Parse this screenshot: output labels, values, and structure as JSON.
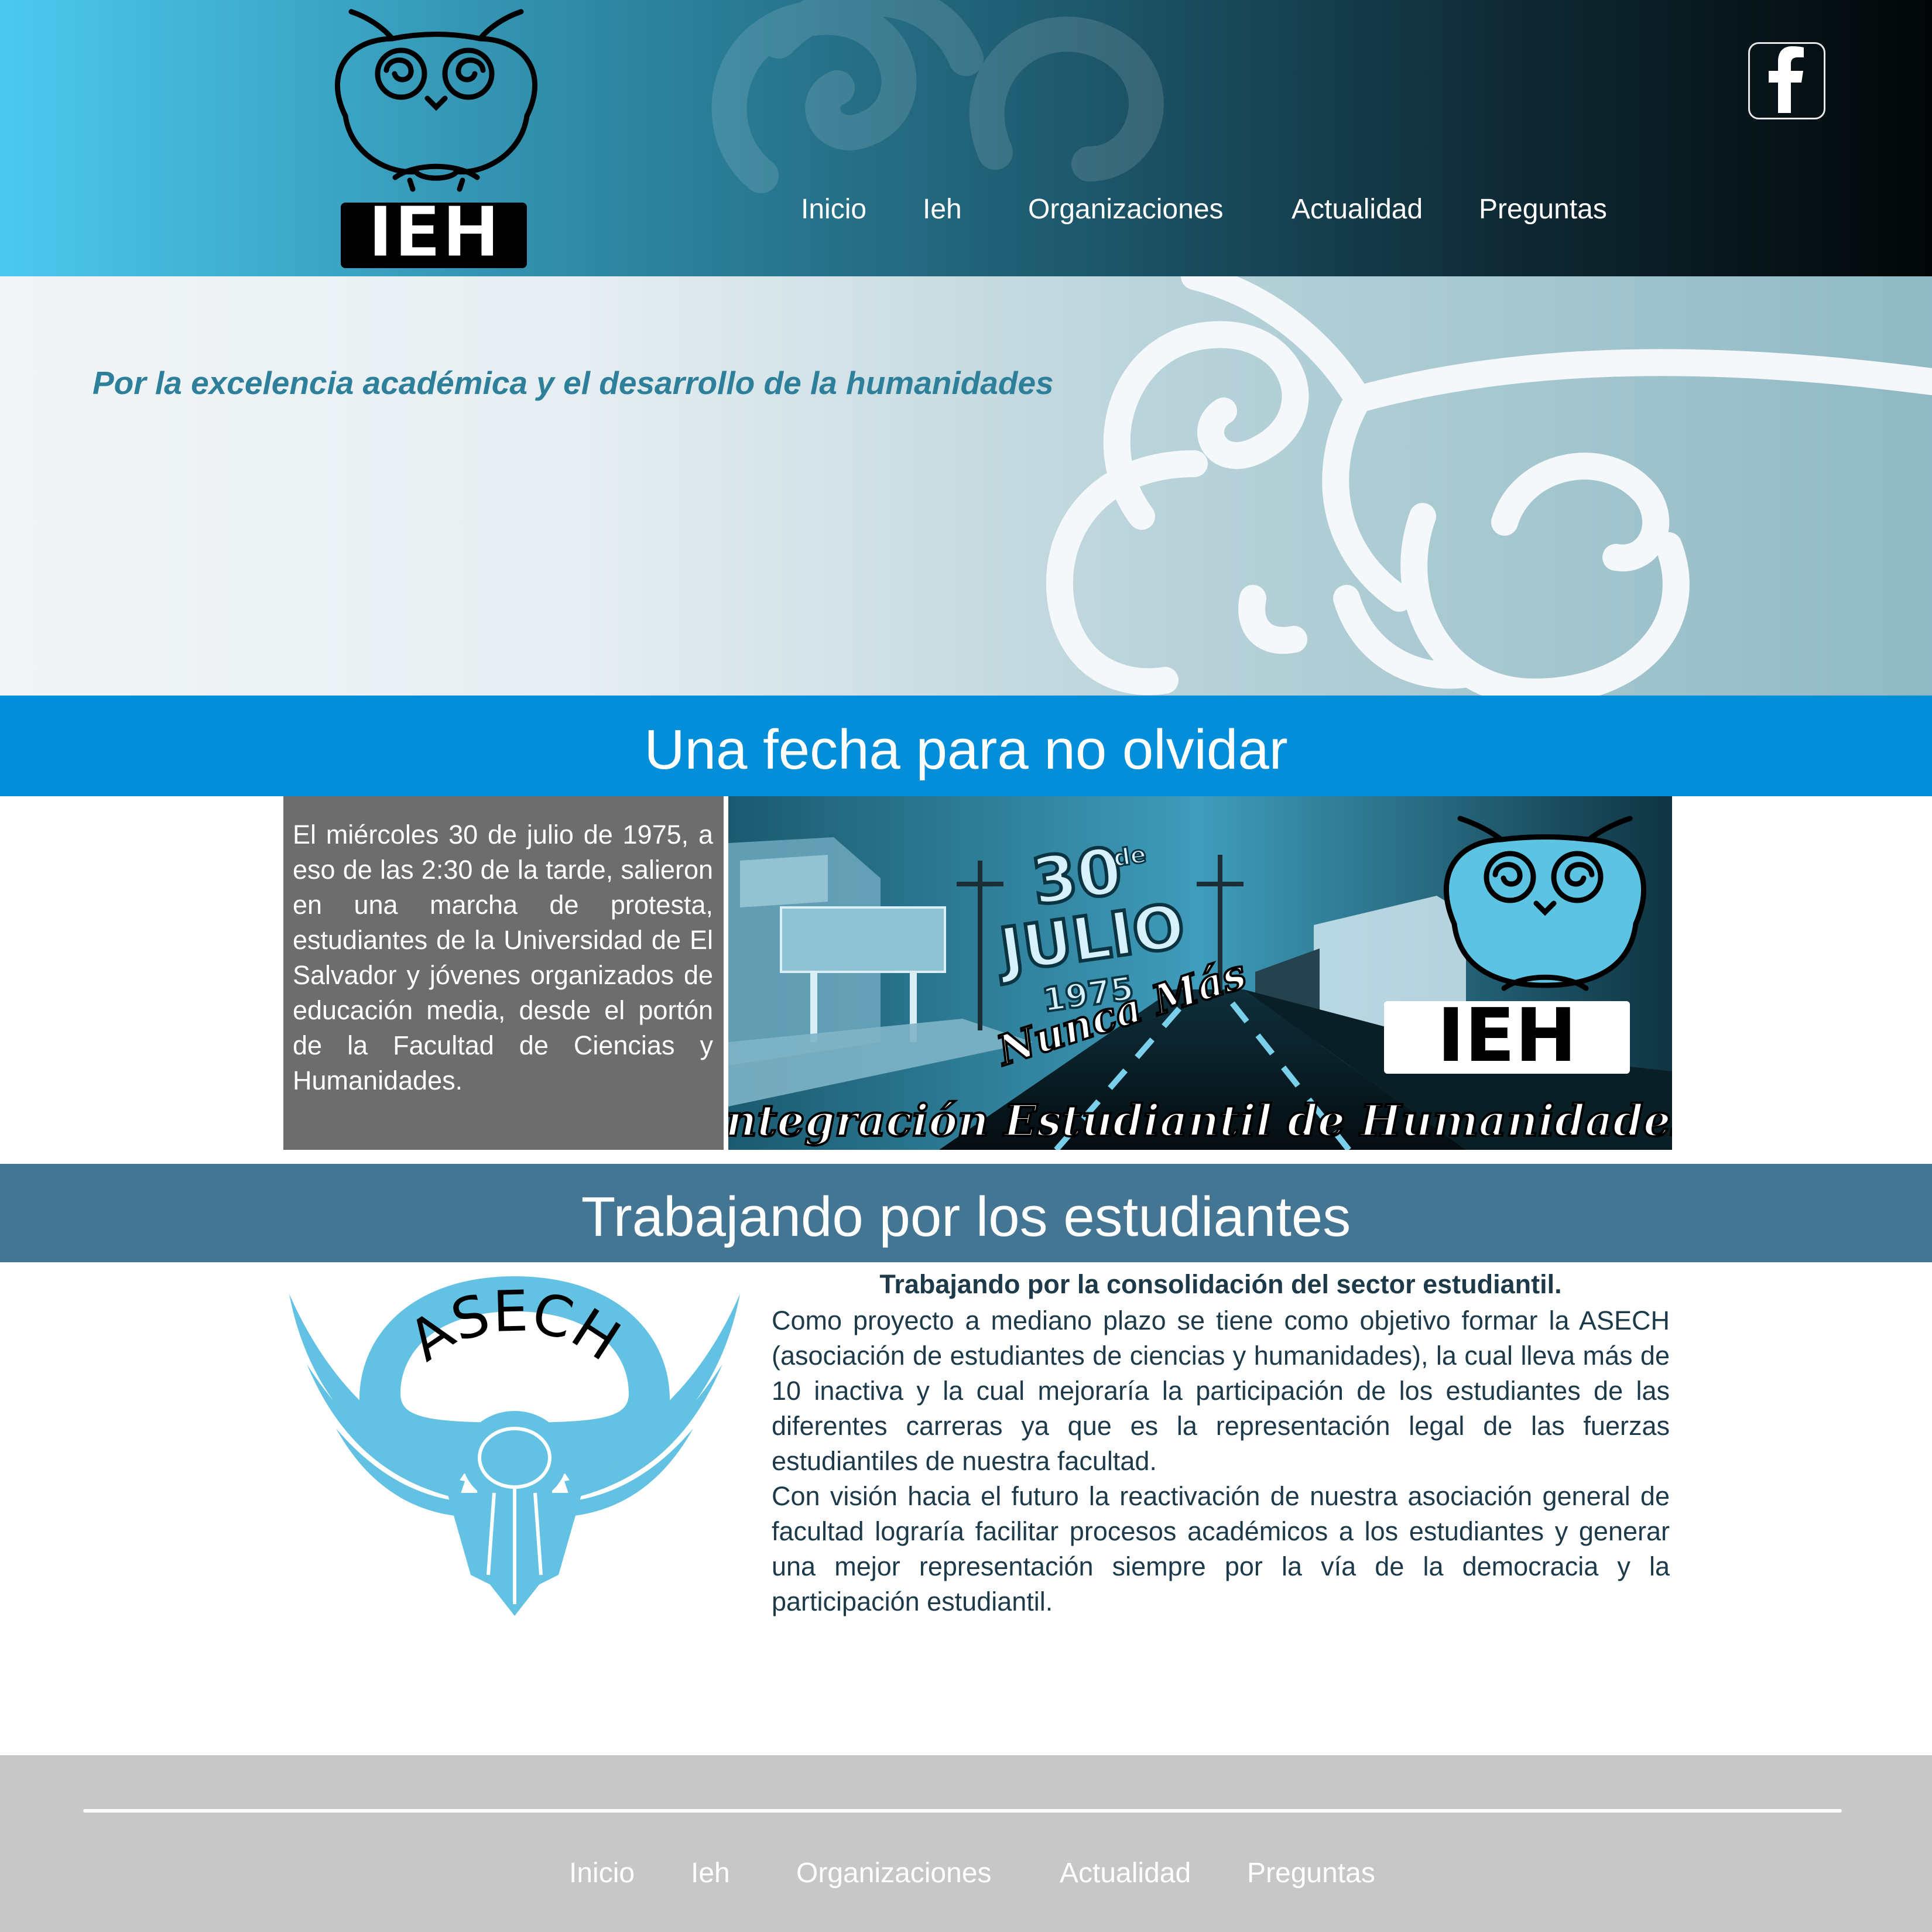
{
  "logo": {
    "text": "IEH"
  },
  "nav": {
    "items": [
      "Inicio",
      "Ieh",
      "Organizaciones",
      "Actualidad",
      "Preguntas"
    ]
  },
  "header": {
    "social_icon": "facebook-icon"
  },
  "hero": {
    "tagline": "Por la excelencia académica y el desarrollo de la humanidades"
  },
  "section1": {
    "title": "Una fecha para no olvidar",
    "story": "El miércoles 30 de julio de 1975, a eso de las 2:30 de la tarde, salieron en una marcha de protesta, estudiantes de la Universidad de El Salvador y jóvenes organizados de educación media, desde el portón de la Facultad de Ciencias y Humanidades.",
    "banner": {
      "day": "30",
      "de": "de",
      "month": "JULIO",
      "year": "1975",
      "slogan": "Nunca Más",
      "logo_text": "IEH",
      "caption": "Integración Estudiantil de Humanidades"
    }
  },
  "section2": {
    "title": "Trabajando por los estudiantes",
    "emblem_text": "ASECH",
    "article_title": "Trabajando por la consolidación del sector estudiantil.",
    "paragraphs": [
      "Como proyecto a mediano plazo se tiene como objetivo formar la ASECH (asociación de estudiantes de ciencias y humanidades), la cual lleva más de 10 inactiva y la cual mejoraría la participación de los estudiantes de las diferentes carreras ya que es la representación legal de las fuerzas estudiantiles de nuestra facultad.",
      "Con visión hacia el futuro la reactivación de nuestra asociación general de facultad lograría facilitar procesos académicos a los estudiantes y generar una mejor representación siempre por la vía de la democracia y la participación estudiantil."
    ]
  },
  "footer": {
    "nav": [
      "Inicio",
      "Ieh",
      "Organizaciones",
      "Actualidad",
      "Preguntas"
    ]
  },
  "colors": {
    "header_gradient_start": "#4cc9ee",
    "header_gradient_end": "#020607",
    "band_blue": "#028ed9",
    "band_steel": "#447592",
    "story_box": "#6d6d6d",
    "tagline": "#2d7f9a",
    "emblem": "#63c2e3",
    "footer": "#c8c7c8"
  }
}
